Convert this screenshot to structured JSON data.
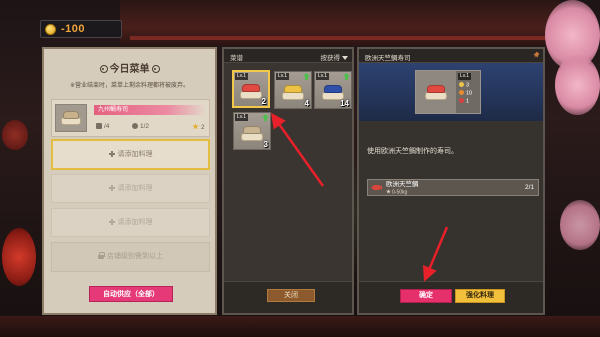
{
  "hud": {
    "coin_value": "-100"
  },
  "menu_panel": {
    "title": "今日菜单",
    "notice": "※营业结束时，菜单上剩余料理都将被废弃。",
    "item": {
      "name": "九州鲷寿司",
      "servings": "/4",
      "ratio": "1/2",
      "stars": "2",
      "topping_color": "#c8b28c"
    },
    "empty_slot_label": "请添加料理",
    "locked_slot_label": "店铺级别需到以上",
    "auto_supply_label": "自动供应（全部）"
  },
  "recipe_panel": {
    "title": "菜谱",
    "sort_label": "按获得",
    "recipes": [
      {
        "level": "Lv.1",
        "count": "2",
        "topping_color": "#e04a40",
        "selected": true
      },
      {
        "level": "Lv.1",
        "count": "4",
        "topping_color": "#ecc246"
      },
      {
        "level": "Lv.1",
        "count": "14",
        "topping_color": "#2f4fa8"
      },
      {
        "level": "Lv.1",
        "count": "3",
        "topping_color": "#c9b491"
      }
    ],
    "close_label": "关闭"
  },
  "detail_panel": {
    "title": "欧洲天竺鲷寿司",
    "level": "Lv.1",
    "stats": [
      "3",
      "10",
      "1"
    ],
    "topping_color": "#e04a40",
    "description": "使用欧洲天竺鲷制作的寿司。",
    "ingredient": {
      "name": "欧洲天竺鲷",
      "weight": "0-50kg",
      "amount": "2/1"
    },
    "confirm_label": "确定",
    "upgrade_label": "强化料理"
  },
  "colors": {
    "accent_pink": "#e6306c",
    "accent_yellow": "#f2c03a",
    "highlight": "#f1c84a",
    "annotation_red": "#e8202a"
  }
}
